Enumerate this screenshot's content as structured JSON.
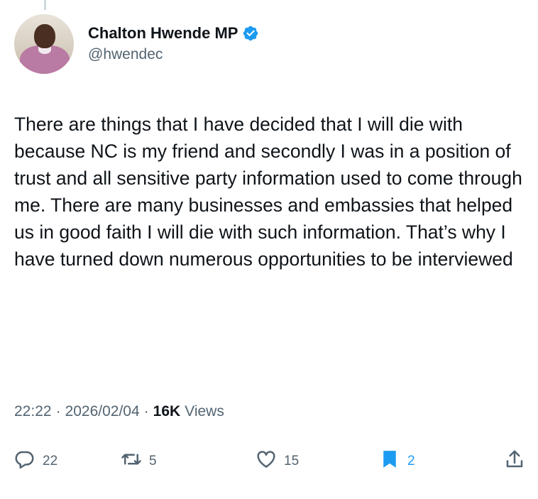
{
  "author": {
    "name": "Chalton Hwende MP",
    "handle": "@hwendec",
    "verified": true,
    "verified_color": "#1d9bf0"
  },
  "tweet": {
    "text": "There are things that I have decided that I will die with because NC is my friend and secondly I was in a position of trust and all sensitive party information used to come through me. There are many businesses and embassies that helped us in good faith I will die with such information. That’s why I have turned down numerous opportunities to be interviewed"
  },
  "meta": {
    "time": "22:22",
    "date": "2026/02/04",
    "separator": "·",
    "views_count": "16K",
    "views_label": "Views"
  },
  "actions": {
    "replies": "22",
    "reposts": "5",
    "likes": "15",
    "bookmarks": "2",
    "accent_color": "#1d9bf0",
    "icon_color": "#536471"
  }
}
